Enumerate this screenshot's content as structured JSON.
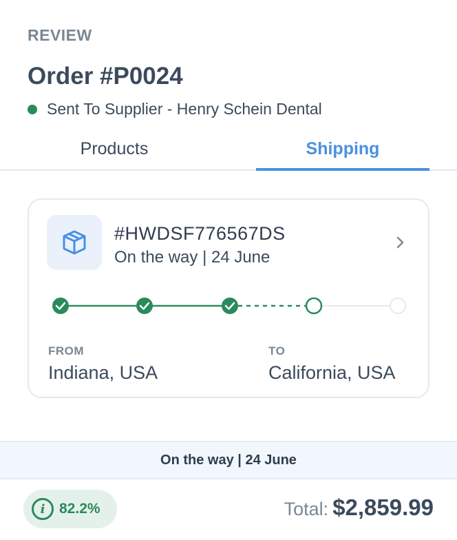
{
  "header": {
    "eyebrow": "REVIEW",
    "title": "Order #P0024",
    "status_text": "Sent To Supplier - Henry Schein Dental",
    "status_color": "#2a8a5c"
  },
  "tabs": [
    {
      "label": "Products",
      "active": false
    },
    {
      "label": "Shipping",
      "active": true
    }
  ],
  "shipment": {
    "icon": "package-icon",
    "tracking_number": "#HWDSF776567DS",
    "status": "On the way | 24 June",
    "steps": [
      "completed",
      "completed",
      "completed",
      "current",
      "pending"
    ],
    "from_label": "FROM",
    "from_value": "Indiana, USA",
    "to_label": "TO",
    "to_value": "California, USA"
  },
  "banner": {
    "text": "On the way | 24 June"
  },
  "footer": {
    "score": "82.2%",
    "score_icon": "info-icon",
    "total_label": "Total:",
    "total_amount": "$2,859.99"
  },
  "colors": {
    "accent": "#4a90e2",
    "success": "#2a8a5c",
    "text": "#3b4a5c",
    "muted": "#7a8794"
  }
}
